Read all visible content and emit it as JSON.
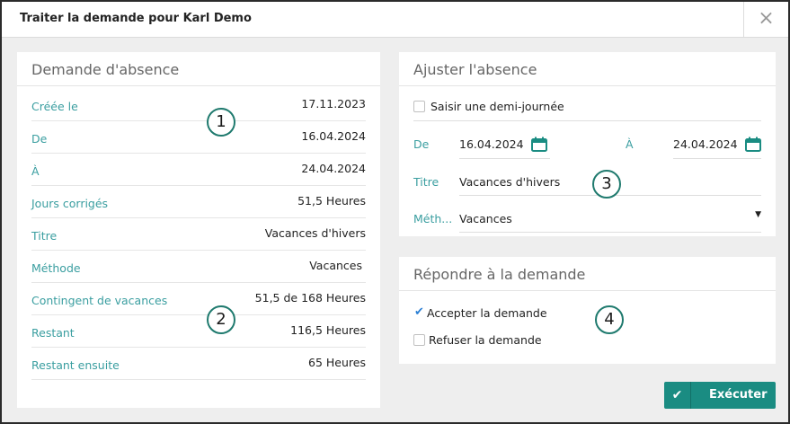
{
  "dialog": {
    "title": "Traiter la demande pour Karl Demo",
    "close_label": "×"
  },
  "absence_request": {
    "title": "Demande d'absence",
    "rows": [
      {
        "label": "Créée le",
        "value": "17.11.2023"
      },
      {
        "label": "De",
        "value": "16.04.2024"
      },
      {
        "label": "À",
        "value": "24.04.2024"
      },
      {
        "label": "Jours corrigés",
        "value": "51,5 Heures"
      },
      {
        "label": "Titre",
        "value": "Vacances d'hivers"
      },
      {
        "label": "Méthode",
        "value": "Vacances"
      },
      {
        "label": "Contingent de vacances",
        "value": "51,5 de 168 Heures"
      },
      {
        "label": "Restant",
        "value": "116,5 Heures"
      },
      {
        "label": "Restant ensuite",
        "value": "65 Heures"
      }
    ]
  },
  "adjust": {
    "title": "Ajuster l'absence",
    "half_day_label": "Saisir une demi-journée",
    "from_label": "De",
    "from_value": "16.04.2024",
    "to_label": "À",
    "to_value": "24.04.2024",
    "title_label": "Titre",
    "title_value": "Vacances d'hivers",
    "method_label": "Méth...",
    "method_value": "Vacances"
  },
  "respond": {
    "title": "Répondre à la demande",
    "accept_label": "Accepter la demande",
    "reject_label": "Refuser la demande"
  },
  "badges": [
    "1",
    "2",
    "3",
    "4"
  ],
  "execute_label": "Exécuter",
  "colors": {
    "accent": "#1a8c82",
    "label": "#3a9ea0",
    "check": "#2a7fd4"
  }
}
